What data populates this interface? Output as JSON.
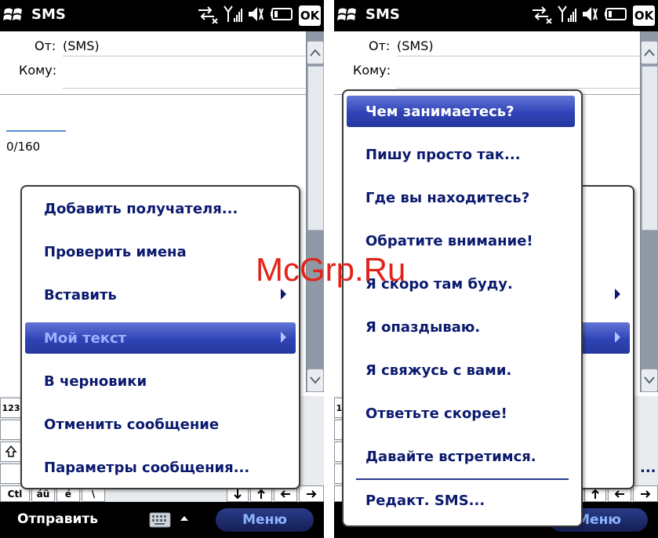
{
  "status": {
    "app_title": "SMS",
    "ok_label": "OK"
  },
  "message": {
    "from_label": "От:",
    "from_value": "(SMS)",
    "to_label": "Кому:",
    "char_count": "0/160"
  },
  "keyboard": {
    "row1": [
      "123"
    ],
    "row4": [
      "Ctl",
      "áü",
      "é",
      "\\"
    ]
  },
  "softkeys": {
    "left": "Отправить",
    "right": "Меню"
  },
  "context_menu": {
    "items": [
      {
        "label": "Добавить получателя..."
      },
      {
        "label": "Проверить имена"
      },
      {
        "label": "Вставить",
        "has_submenu": true
      },
      {
        "label": "Мой текст",
        "has_submenu": true,
        "selected": true
      },
      {
        "label": "В черновики"
      },
      {
        "label": "Отменить сообщение"
      },
      {
        "label": "Параметры сообщения..."
      }
    ]
  },
  "my_text_submenu": {
    "items": [
      {
        "label": "Чем занимаетесь?",
        "selected": true
      },
      {
        "label": "Пишу просто так..."
      },
      {
        "label": "Где вы находитесь?"
      },
      {
        "label": "Обратите внимание!"
      },
      {
        "label": "Я скоро там буду."
      },
      {
        "label": "Я опаздываю."
      },
      {
        "label": "Я свяжусь с вами."
      },
      {
        "label": "Ответьте скорее!"
      },
      {
        "label": "Давайте встретимся."
      }
    ],
    "edit_label": "Редакт. SMS..."
  },
  "right_screen_partial": {
    "menu_fragment": "..."
  },
  "watermark": "McGrp.Ru",
  "colors": {
    "menu_text": "#0b1a6e",
    "selection_blue": "#2f43b6",
    "softkey_blue": "#8db4ff",
    "watermark_red": "#e2231a"
  }
}
